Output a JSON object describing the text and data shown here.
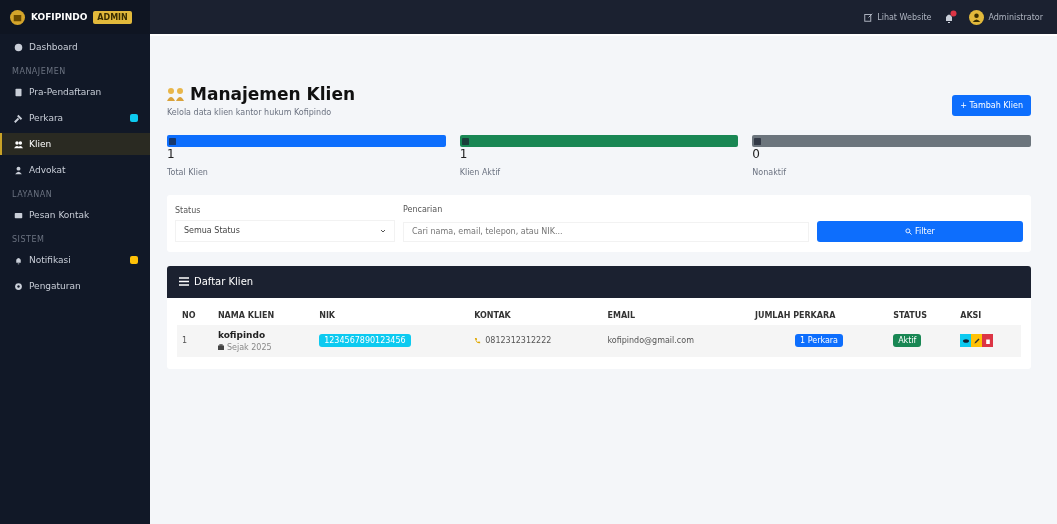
{
  "sidebar": {
    "brand": "KOFIPINDO",
    "brand_badge": "ADMIN",
    "groups": [
      {
        "items": [
          {
            "label": "Dashboard",
            "selected": false
          }
        ]
      },
      {
        "heading": "MANAJEMEN",
        "items": [
          {
            "label": "Pra-Pendaftaran",
            "selected": false
          },
          {
            "label": "Perkara",
            "selected": false,
            "color": "#0dcaf0"
          },
          {
            "label": "Klien",
            "selected": true
          },
          {
            "label": "Advokat",
            "selected": false
          }
        ]
      },
      {
        "heading": "LAYANAN",
        "items": [
          {
            "label": "Pesan Kontak",
            "selected": false
          }
        ]
      },
      {
        "heading": "SISTEM",
        "items": [
          {
            "label": "Notifikasi",
            "selected": false,
            "color": "#ffc107"
          },
          {
            "label": "Pengaturan",
            "selected": false
          }
        ]
      }
    ]
  },
  "topbar": {
    "website_link": "Lihat Website",
    "user": "Administrator"
  },
  "page": {
    "title": "Manajemen Klien",
    "subtitle": "Kelola data klien kantor hukum Kofipindo",
    "add_button": "+ Tambah Klien"
  },
  "stats": [
    {
      "value": "1",
      "label": "Total Klien",
      "color": "#0d6efd"
    },
    {
      "value": "1",
      "label": "Klien Aktif",
      "color": "#198754"
    },
    {
      "value": "0",
      "label": "Nonaktif",
      "color": "#6c757d"
    }
  ],
  "filter": {
    "status_label": "Status",
    "status_value": "Semua Status",
    "search_label": "Pencarian",
    "search_placeholder": "Cari nama, email, telepon, atau NIK...",
    "button": "Filter"
  },
  "table": {
    "title": "Daftar Klien",
    "columns": [
      "NO",
      "NAMA KLIEN",
      "NIK",
      "KONTAK",
      "EMAIL",
      "JUMLAH PERKARA",
      "STATUS",
      "AKSI"
    ],
    "rows": [
      {
        "no": "1",
        "name": "kofipindo",
        "sub": "Sejak 2025",
        "nik": "1234567890123456",
        "phone": "0812312312222",
        "email": "kofipindo@gmail.com",
        "cases": "1 Perkara",
        "status": "Aktif"
      }
    ]
  }
}
